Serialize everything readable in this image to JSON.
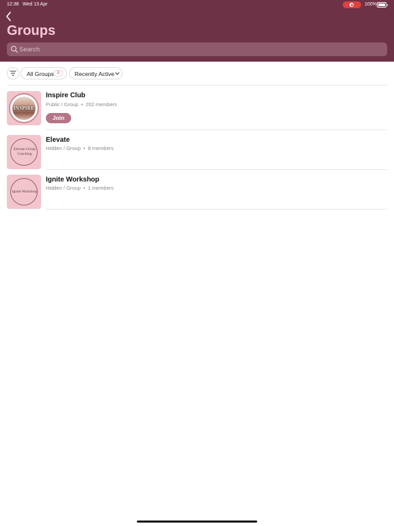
{
  "status_bar": {
    "time": "12:38",
    "date": "Wed 13 Apr",
    "battery": "100%"
  },
  "colors": {
    "header_bg": "#6e3246",
    "title": "#f4c9d4",
    "search_bg": "#8f5a6b",
    "accent_button": "#b57586",
    "thumb_bg": "#f2c5cd",
    "recording": "#e0403f"
  },
  "header": {
    "title": "Groups",
    "search_placeholder": "Search"
  },
  "filters": {
    "all_groups_label": "All Groups",
    "all_groups_count": "3",
    "sort_label": "Recently Active"
  },
  "groups": [
    {
      "name": "Inspire Club",
      "visibility": "Public / Group",
      "members": "202 members",
      "thumb_text": "INSPIRE",
      "action": "Join"
    },
    {
      "name": "Elevate",
      "visibility": "Hidden / Group",
      "members": "8 members",
      "thumb_text": "Elevate Group Coaching"
    },
    {
      "name": "Ignite Workshop",
      "visibility": "Hidden / Group",
      "members": "1 members",
      "thumb_text": "Ignite Workshop"
    }
  ],
  "icons": {
    "back": "chevron-left-icon",
    "search": "search-icon",
    "filter": "filter-icon",
    "sort": "chevron-down-icon",
    "recording": "screen-record-icon",
    "battery": "battery-charging-icon"
  }
}
